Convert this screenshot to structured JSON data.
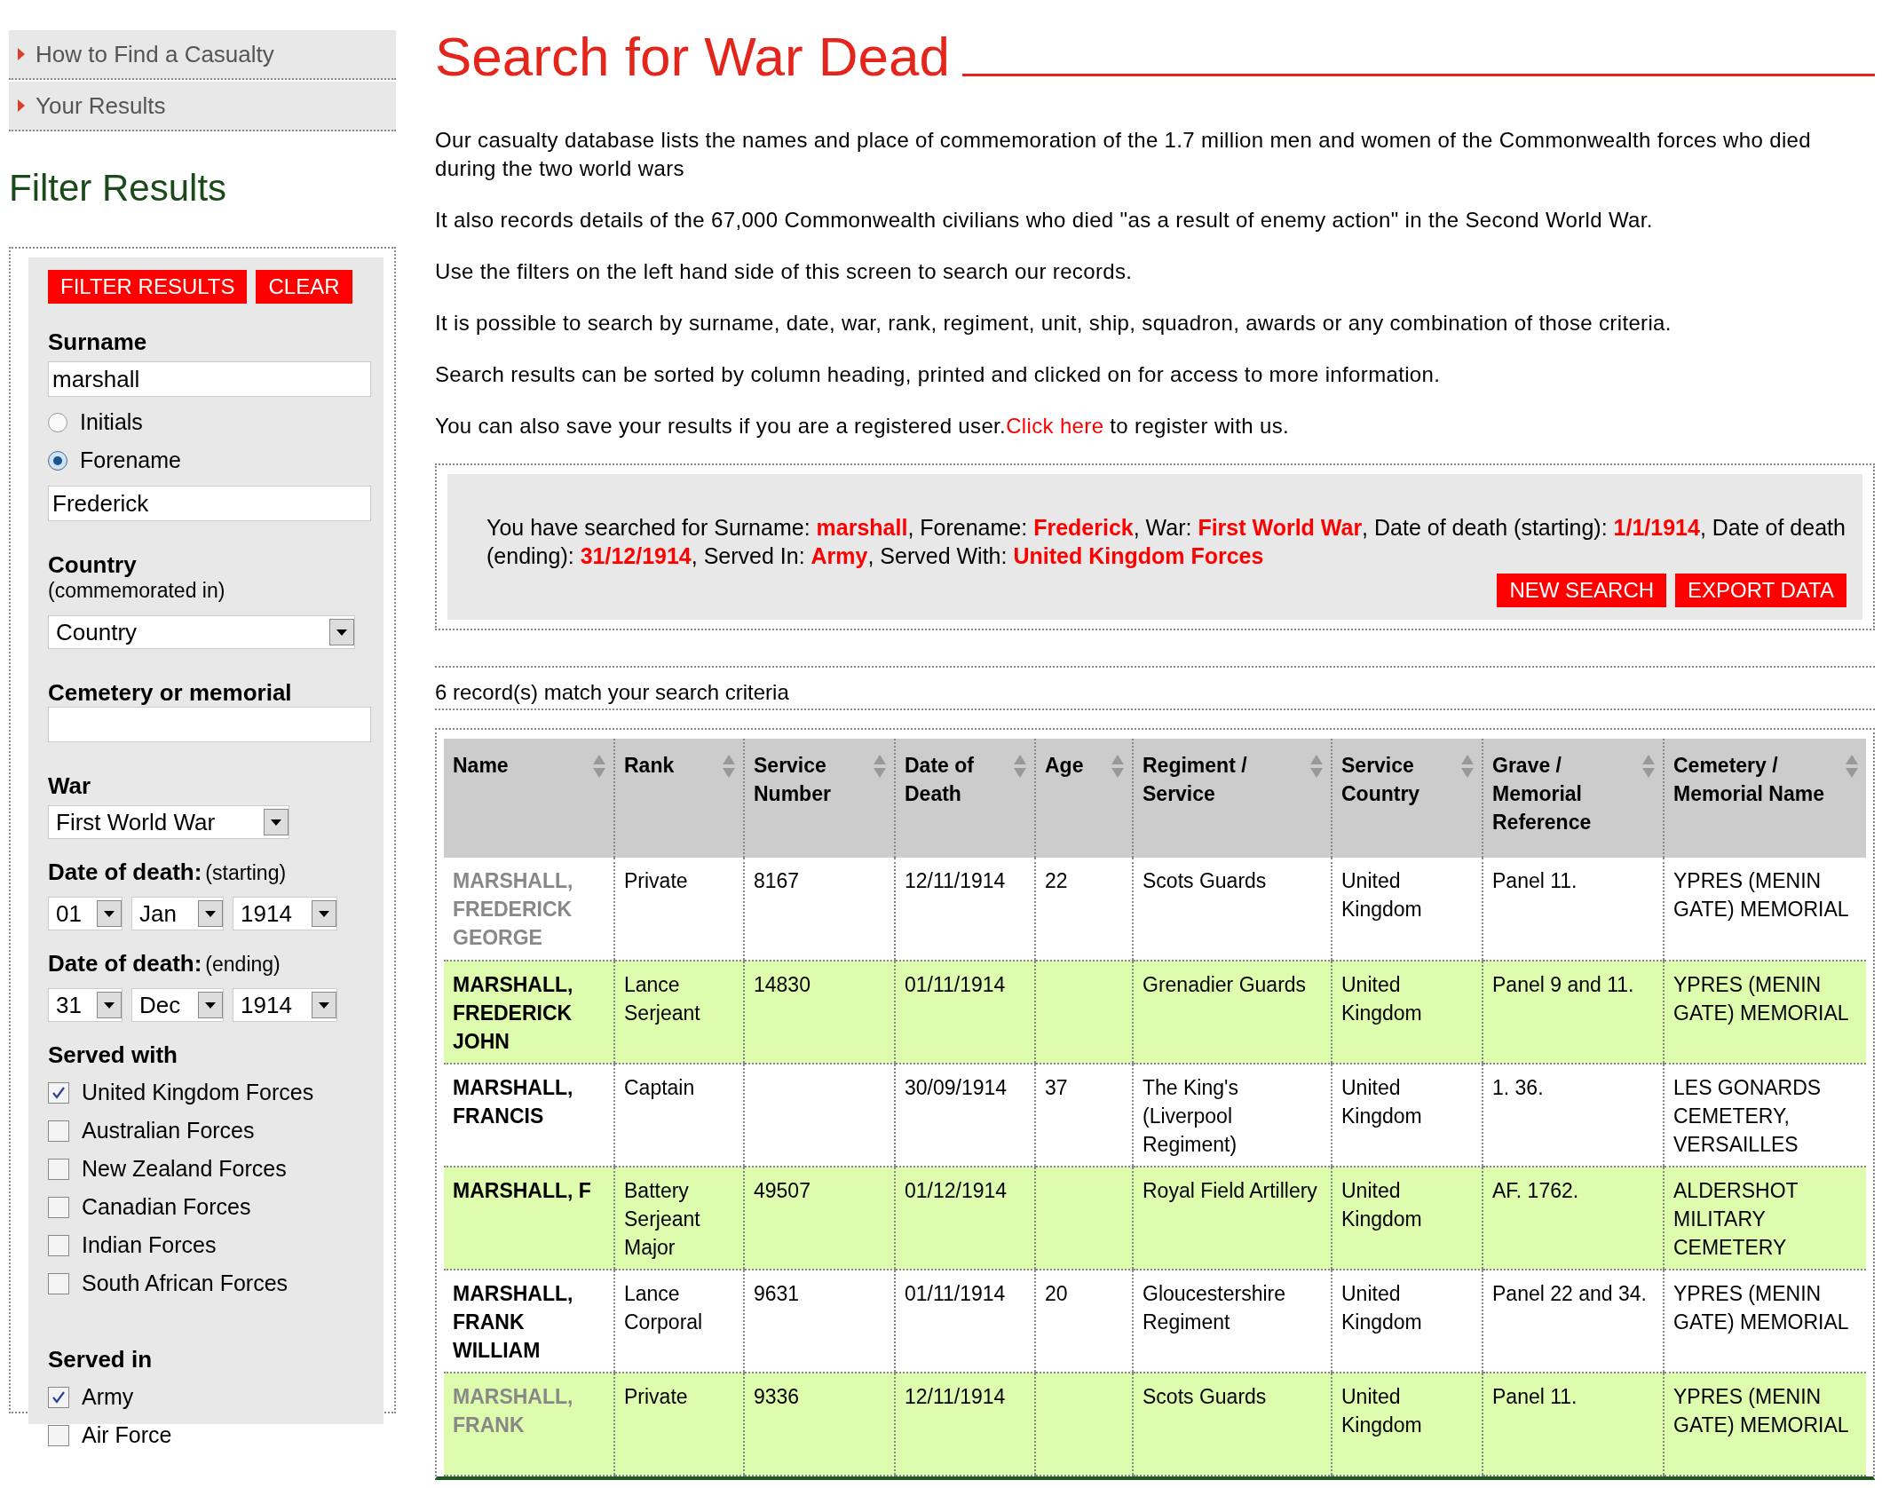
{
  "sidebar": {
    "nav": [
      {
        "label": "How to Find a Casualty"
      },
      {
        "label": "Your Results"
      }
    ],
    "heading": "Filter Results",
    "buttons": [
      "FILTER RESULTS",
      "CLEAR"
    ],
    "surname": {
      "label": "Surname",
      "value": "marshall"
    },
    "name_mode": [
      {
        "label": "Initials",
        "selected": false
      },
      {
        "label": "Forename",
        "selected": true
      }
    ],
    "forename": {
      "value": "Frederick"
    },
    "country": {
      "label": "Country",
      "note": "(commemorated in)",
      "value": "Country"
    },
    "cemetery": {
      "label": "Cemetery or memorial"
    },
    "war": {
      "label": "War",
      "value": "First World War"
    },
    "date_start": {
      "label": "Date of death:",
      "note": "(starting)",
      "day": "01",
      "month": "Jan",
      "year": "1914"
    },
    "date_end": {
      "label": "Date of death:",
      "note": "(ending)",
      "day": "31",
      "month": "Dec",
      "year": "1914"
    },
    "served_with": {
      "label": "Served with",
      "options": [
        {
          "label": "United Kingdom Forces",
          "checked": true
        },
        {
          "label": "Australian Forces",
          "checked": false
        },
        {
          "label": "New Zealand Forces",
          "checked": false
        },
        {
          "label": "Canadian Forces",
          "checked": false
        },
        {
          "label": "Indian Forces",
          "checked": false
        },
        {
          "label": "South African Forces",
          "checked": false
        }
      ]
    },
    "served_in": {
      "label": "Served in",
      "options": [
        {
          "label": "Army",
          "checked": true
        },
        {
          "label": "Air Force",
          "checked": false
        }
      ]
    }
  },
  "main": {
    "title": "Search for War Dead",
    "paragraphs": [
      {
        "text": "Our casualty database lists the names and place of commemoration of the 1.7 million men and women of the Commonwealth forces who died during the two world wars"
      },
      {
        "text": "It also records details of the 67,000 Commonwealth civilians who died \"as a result of enemy action\" in the Second World War."
      },
      {
        "text": "Use the filters on the left hand side of this screen to search our records."
      },
      {
        "text": "It is possible to search by surname, date, war, rank, regiment, unit, ship, squadron, awards or any combination of those criteria."
      },
      {
        "text": "Search results can be sorted by column heading, printed and clicked on for access to more information."
      },
      {
        "text": "You can also save your results if you are a registered user.",
        "link": "Click here",
        "after": "to register with us."
      }
    ],
    "summary": "You have searched for Surname: **marshall**, Forename: **Frederick**, War: **First World War**, Date of death (starting): **1/1/1914**, Date of death (ending): **31/12/1914**, Served In: **Army**, Served With: **United Kingdom Forces**",
    "summary_buttons": [
      "NEW SEARCH",
      "EXPORT DATA"
    ],
    "count": "6 record(s) match your search criteria",
    "table": {
      "columns": [
        "Name",
        "Rank",
        "Service Number",
        "Date of Death",
        "Age",
        "Regiment / Service",
        "Service Country",
        "Grave / Memorial Reference",
        "Cemetery / Memorial Name"
      ],
      "rows": [
        {
          "visited": true,
          "cells": [
            "MARSHALL, FREDERICK GEORGE",
            "Private",
            "8167",
            "12/11/1914",
            "22",
            "Scots Guards",
            "United Kingdom",
            "Panel 11.",
            "YPRES (MENIN GATE) MEMORIAL"
          ]
        },
        {
          "visited": false,
          "cells": [
            "MARSHALL, FREDERICK JOHN",
            "Lance Serjeant",
            "14830",
            "01/11/1914",
            "",
            "Grenadier Guards",
            "United Kingdom",
            "Panel 9 and 11.",
            "YPRES (MENIN GATE) MEMORIAL"
          ]
        },
        {
          "visited": false,
          "cells": [
            "MARSHALL, FRANCIS",
            "Captain",
            "",
            "30/09/1914",
            "37",
            "The King's (Liverpool Regiment)",
            "United Kingdom",
            "1. 36.",
            "LES GONARDS CEMETERY, VERSAILLES"
          ]
        },
        {
          "visited": false,
          "cells": [
            "MARSHALL, F",
            "Battery Serjeant Major",
            "49507",
            "01/12/1914",
            "",
            "Royal Field Artillery",
            "United Kingdom",
            "AF. 1762.",
            "ALDERSHOT MILITARY CEMETERY"
          ]
        },
        {
          "visited": false,
          "cells": [
            "MARSHALL, FRANK WILLIAM",
            "Lance Corporal",
            "9631",
            "01/11/1914",
            "20",
            "Gloucestershire Regiment",
            "United Kingdom",
            "Panel 22 and 34.",
            "YPRES (MENIN GATE) MEMORIAL"
          ]
        },
        {
          "visited": true,
          "cells": [
            "MARSHALL, FRANK",
            "Private",
            "9336",
            "12/11/1914",
            "",
            "Scots Guards",
            "United Kingdom",
            "Panel 11.",
            "YPRES (MENIN GATE) MEMORIAL"
          ]
        }
      ]
    }
  }
}
